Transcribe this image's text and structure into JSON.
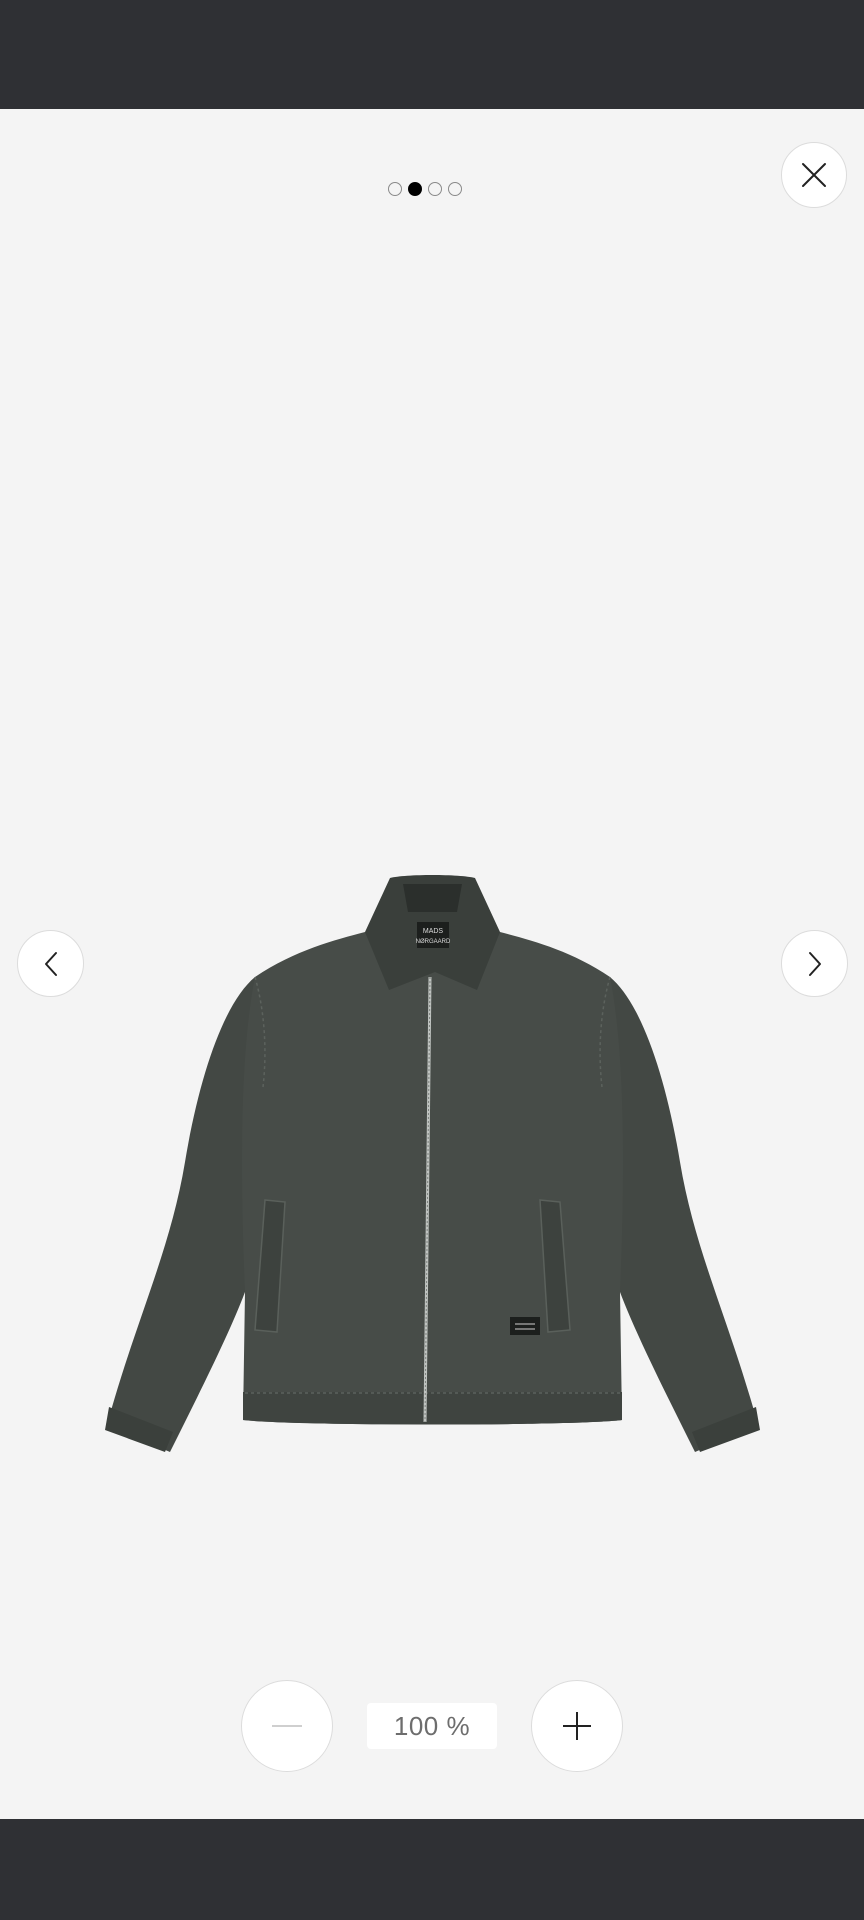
{
  "viewer": {
    "pagination": {
      "total": 4,
      "active_index": 1
    },
    "zoom": {
      "level_label": "100 %"
    },
    "icons": {
      "close": "close-icon",
      "prev": "chevron-left-icon",
      "next": "chevron-right-icon",
      "zoom_out": "minus-icon",
      "zoom_in": "plus-icon"
    },
    "product": {
      "image": "dark-green-canvas-zip-jacket",
      "label_lines": [
        "MADS",
        "NØRGAARD"
      ]
    }
  },
  "colors": {
    "system_bar": "#2f3034",
    "background": "#f4f4f4",
    "button_bg": "#ffffff",
    "jacket": "#434844"
  }
}
